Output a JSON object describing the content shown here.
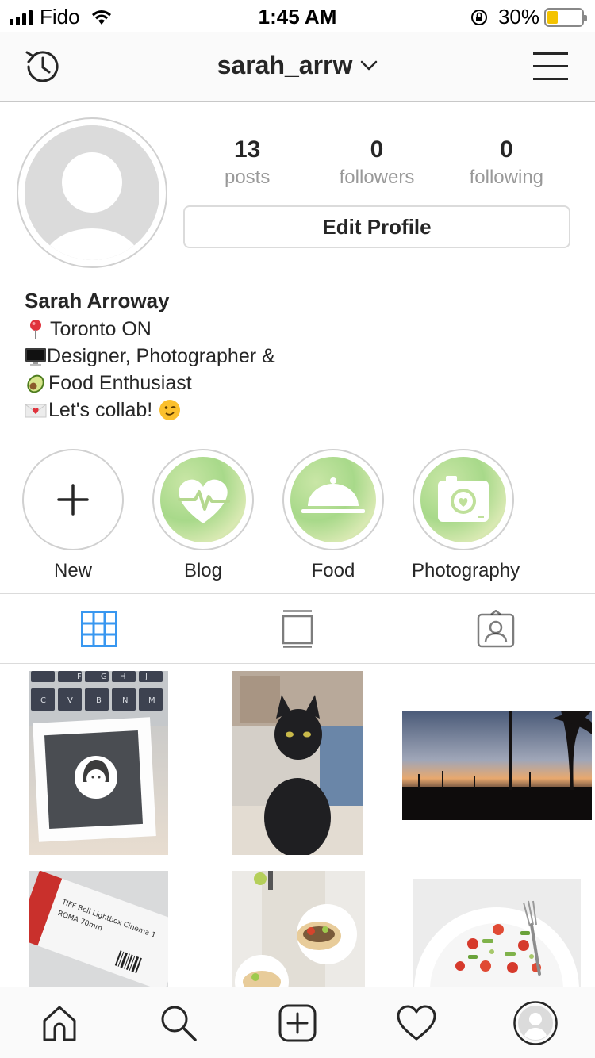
{
  "status_bar": {
    "carrier": "Fido",
    "time": "1:45 AM",
    "battery_percent": "30%",
    "battery_level": 0.3
  },
  "nav": {
    "username": "sarah_arrw",
    "history_icon": "history-icon",
    "menu_icon": "hamburger-menu-icon"
  },
  "profile": {
    "stats": [
      {
        "value": "13",
        "label": "posts"
      },
      {
        "value": "0",
        "label": "followers"
      },
      {
        "value": "0",
        "label": "following"
      }
    ],
    "edit_button": "Edit Profile"
  },
  "bio": {
    "name": "Sarah Arroway",
    "lines": [
      {
        "emoji": "pin-emoji",
        "text": "Toronto ON"
      },
      {
        "emoji": "computer-emoji",
        "text": "Designer, Photographer &"
      },
      {
        "emoji": "avocado-emoji",
        "text": "Food Enthusiast"
      },
      {
        "emoji": "love-letter-emoji",
        "text": "Let's collab!"
      }
    ]
  },
  "highlights": [
    {
      "label": "New",
      "icon": "plus-icon"
    },
    {
      "label": "Blog",
      "icon": "heartbeat-icon"
    },
    {
      "label": "Food",
      "icon": "cloche-icon"
    },
    {
      "label": "Photography",
      "icon": "camera-heart-icon"
    }
  ],
  "tabs": [
    {
      "name": "grid-view",
      "icon": "grid-icon",
      "active": true
    },
    {
      "name": "feed-view",
      "icon": "feed-icon",
      "active": false
    },
    {
      "name": "tagged-view",
      "icon": "tagged-user-icon",
      "active": false
    }
  ],
  "posts": [
    {
      "subject": "sticker on laptop keyboard"
    },
    {
      "subject": "black cat"
    },
    {
      "subject": "sunset palm trees"
    },
    {
      "subject": "TIFF ticket"
    },
    {
      "subject": "tacos on table"
    },
    {
      "subject": "salad bowl"
    }
  ],
  "keyboard_keys": [
    "F",
    "G",
    "H",
    "J",
    "C",
    "V",
    "B",
    "N",
    "M"
  ],
  "ticket_text": [
    "TIFF Bell Lightbox Cinema 1",
    "ROMA 70mm"
  ],
  "bottom_nav": [
    {
      "name": "home",
      "icon": "home-icon"
    },
    {
      "name": "search",
      "icon": "search-icon"
    },
    {
      "name": "new-post",
      "icon": "add-post-icon"
    },
    {
      "name": "activity",
      "icon": "heart-icon"
    },
    {
      "name": "profile",
      "icon": "profile-avatar-icon"
    }
  ],
  "colors": {
    "active_tab": "#3897f0",
    "text": "#262626",
    "muted": "#999999",
    "border": "#dbdbdb",
    "battery": "#f4c300"
  }
}
